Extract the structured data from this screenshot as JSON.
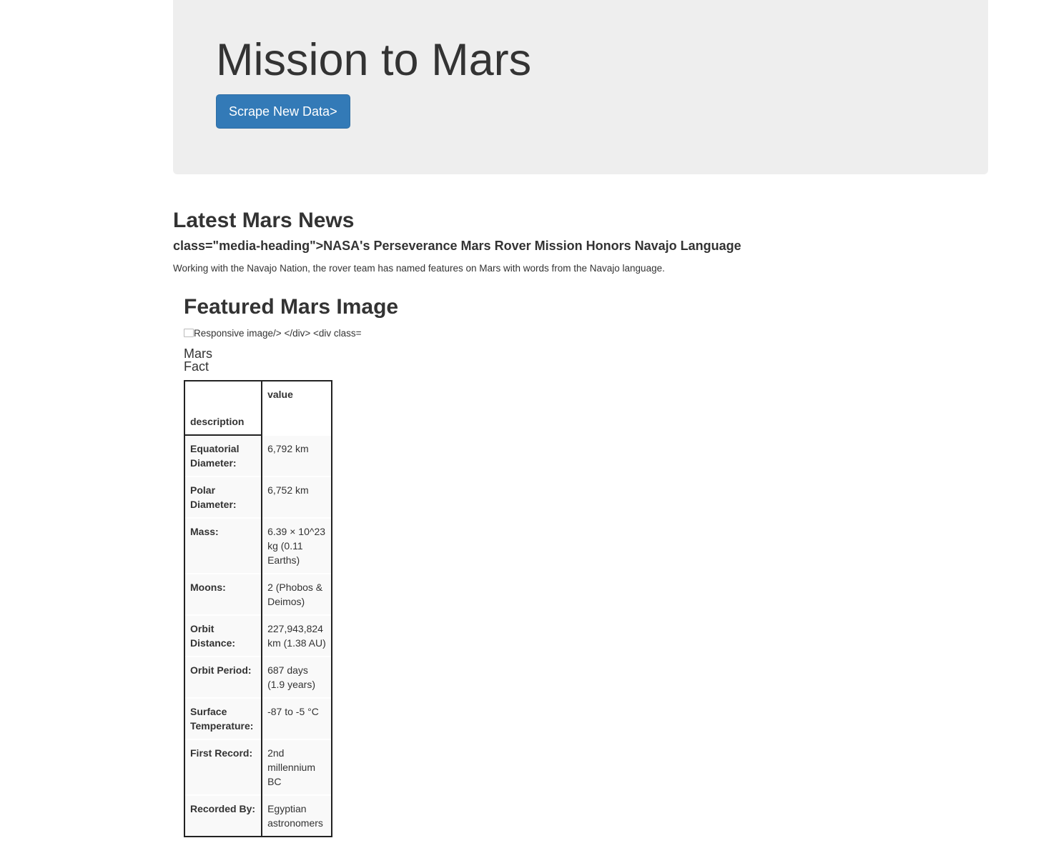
{
  "header": {
    "title": "Mission to Mars",
    "scrape_button": "Scrape New Data>"
  },
  "news": {
    "section_title": "Latest Mars News",
    "headline": "class=\"media-heading\">NASA's Perseverance Mars Rover Mission Honors Navajo Language",
    "paragraph": "Working with the Navajo Nation, the rover team has named features on Mars with words from the Navajo language."
  },
  "featured": {
    "section_title": "Featured Mars Image",
    "image_alt_text": "Responsive image/> </div> <div class="
  },
  "facts": {
    "title": "Mars Fact",
    "header_col1": "",
    "header_col2": "value",
    "index_label": "description",
    "rows": [
      {
        "label": "Equatorial Diameter:",
        "value": "6,792 km"
      },
      {
        "label": "Polar Diameter:",
        "value": "6,752 km"
      },
      {
        "label": "Mass:",
        "value": "6.39 × 10^23 kg (0.11 Earths)"
      },
      {
        "label": "Moons:",
        "value": "2 (Phobos & Deimos)"
      },
      {
        "label": "Orbit Distance:",
        "value": "227,943,824 km (1.38 AU)"
      },
      {
        "label": "Orbit Period:",
        "value": "687 days (1.9 years)"
      },
      {
        "label": "Surface Temperature:",
        "value": "-87 to -5 °C"
      },
      {
        "label": "First Record:",
        "value": "2nd millennium BC"
      },
      {
        "label": "Recorded By:",
        "value": "Egyptian astronomers"
      }
    ]
  },
  "colors": {
    "jumbotron_bg": "#eeeeee",
    "button_primary": "#337ab7",
    "text": "#333333"
  }
}
